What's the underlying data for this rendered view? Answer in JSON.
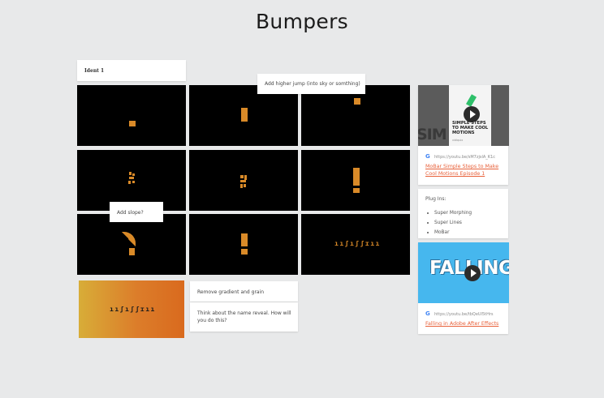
{
  "page": {
    "title": "Bumpers"
  },
  "ident_label": "Ident 1",
  "notes": {
    "higher_jump": "Add higher jump (into sky or somthing)",
    "add_slope": "Add slope?",
    "remove_gradient": "Remove gradient and grain",
    "name_reveal": "Think about the name reveal. How will you do this?"
  },
  "frames": {
    "logo_text": "ııʃıʃʃɪıı",
    "final_text": "ııʃıʃʃɪıı"
  },
  "link_card_1": {
    "thumb_text": "SIMPLE STEPS TO MAKE COOL MOTIONS",
    "thumb_bg_text": "SIM PS",
    "thumb_brand": "vidiquix",
    "url": "https://youtu.be/sM7zjslA_K1c",
    "title": "MoBar Simple Steps to Make Cool Motions Episode 1",
    "play_icon": "play-icon",
    "source_icon": "google-icon"
  },
  "plugins": {
    "heading": "Plug Ins:",
    "items": [
      "Super Morphing",
      "Super Lines",
      "MoBar"
    ]
  },
  "link_card_2": {
    "thumb_text": "FALLING",
    "url": "https://youtu.be/tbQeUl5tHrs",
    "title": "Falling in Adobe After Effects",
    "play_icon": "play-icon",
    "source_icon": "google-icon"
  },
  "colors": {
    "background": "#e8e9ea",
    "frame": "#000000",
    "accent_orange": "#d98a28",
    "link": "#e8613a"
  }
}
